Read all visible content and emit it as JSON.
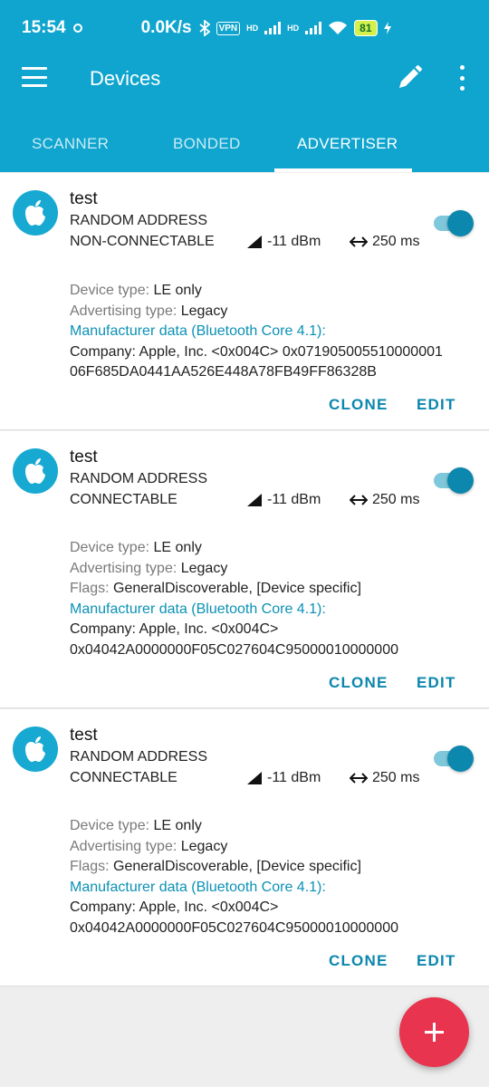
{
  "status_bar": {
    "time": "15:54",
    "net_speed": "0.0K/s",
    "vpn": "VPN",
    "hd1": "HD",
    "hd2": "HD",
    "battery": "81",
    "icons": [
      "bluetooth-icon",
      "signal-icon",
      "wifi-icon",
      "charging-icon"
    ]
  },
  "toolbar": {
    "title": "Devices",
    "icons": [
      "menu-icon",
      "pencil-icon",
      "more-vert-icon"
    ]
  },
  "tabs": [
    {
      "label": "SCANNER"
    },
    {
      "label": "BONDED"
    },
    {
      "label": "ADVERTISER",
      "active": true
    }
  ],
  "advertisers": [
    {
      "name": "test",
      "address_type": "RANDOM ADDRESS",
      "connectable": "NON-CONNECTABLE",
      "tx_power": "-11 dBm",
      "interval": "250 ms",
      "enabled": true,
      "device_type_label": "Device type:",
      "device_type": "LE only",
      "adv_type_label": "Advertising type:",
      "adv_type": "Legacy",
      "flags_label": "",
      "flags": "",
      "mfr_label": "Manufacturer data (Bluetooth Core 4.1):",
      "mfr_line1": "Company: Apple, Inc. <0x004C> 0x071905005510000001",
      "mfr_line2": "06F685DA0441AA526E448A78FB49FF86328B",
      "clone": "CLONE",
      "edit": "EDIT"
    },
    {
      "name": "test",
      "address_type": "RANDOM ADDRESS",
      "connectable": "CONNECTABLE",
      "tx_power": "-11 dBm",
      "interval": "250 ms",
      "enabled": true,
      "device_type_label": "Device type:",
      "device_type": "LE only",
      "adv_type_label": "Advertising type:",
      "adv_type": "Legacy",
      "flags_label": "Flags:",
      "flags": "GeneralDiscoverable, [Device specific]",
      "mfr_label": "Manufacturer data (Bluetooth Core 4.1):",
      "mfr_line1": "Company: Apple, Inc. <0x004C>",
      "mfr_line2": "0x04042A0000000F05C027604C95000010000000",
      "clone": "CLONE",
      "edit": "EDIT"
    },
    {
      "name": "test",
      "address_type": "RANDOM ADDRESS",
      "connectable": "CONNECTABLE",
      "tx_power": "-11 dBm",
      "interval": "250 ms",
      "enabled": true,
      "device_type_label": "Device type:",
      "device_type": "LE only",
      "adv_type_label": "Advertising type:",
      "adv_type": "Legacy",
      "flags_label": "Flags:",
      "flags": "GeneralDiscoverable, [Device specific]",
      "mfr_label": "Manufacturer data (Bluetooth Core 4.1):",
      "mfr_line1": "Company: Apple, Inc. <0x004C>",
      "mfr_line2": "0x04042A0000000F05C027604C95000010000000",
      "clone": "CLONE",
      "edit": "EDIT"
    }
  ],
  "fab": {
    "icon": "plus-icon"
  },
  "colors": {
    "primary": "#0fa5cf",
    "accent": "#e8344e",
    "link": "#0b86ad"
  }
}
